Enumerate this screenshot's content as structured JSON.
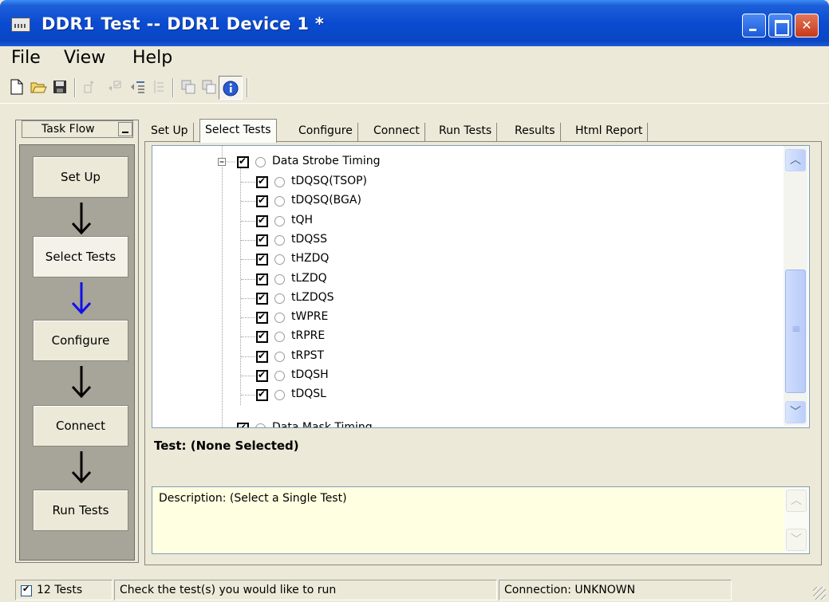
{
  "window": {
    "title": "DDR1 Test -- DDR1 Device 1 *",
    "icon": "app-waveform-icon"
  },
  "menu": [
    "File",
    "View",
    "Help"
  ],
  "toolbar": {
    "icons": [
      "new-file-icon",
      "open-folder-icon",
      "save-icon",
      "export-icon",
      "check-tests-icon",
      "expand-tree-icon",
      "collapse-tree-icon",
      "copy-icon",
      "paste-icon",
      "info-icon"
    ]
  },
  "taskflow": {
    "header": "Task Flow",
    "steps": [
      "Set Up",
      "Select Tests",
      "Configure",
      "Connect",
      "Run Tests"
    ],
    "active_step": "Select Tests",
    "active_arrow_color": "#1010e8"
  },
  "tabs": [
    "Set Up",
    "Select Tests",
    "Configure",
    "Connect",
    "Run Tests",
    "Results",
    "Html Report"
  ],
  "selected_tab": "Select Tests",
  "tree": {
    "group": "Data Strobe Timing",
    "items": [
      "tDQSQ(TSOP)",
      "tDQSQ(BGA)",
      "tQH",
      "tDQSS",
      "tHZDQ",
      "tLZDQ",
      "tLZDQS",
      "tWPRE",
      "tRPRE",
      "tRPST",
      "tDQSH",
      "tDQSL"
    ],
    "next_group": "Data Mask Timing"
  },
  "test_info": "Test: (None Selected)",
  "description": "Description: (Select a Single Test)",
  "status": {
    "count": "12 Tests",
    "hint": "Check the test(s) you would like to run",
    "connection": "Connection: UNKNOWN"
  }
}
